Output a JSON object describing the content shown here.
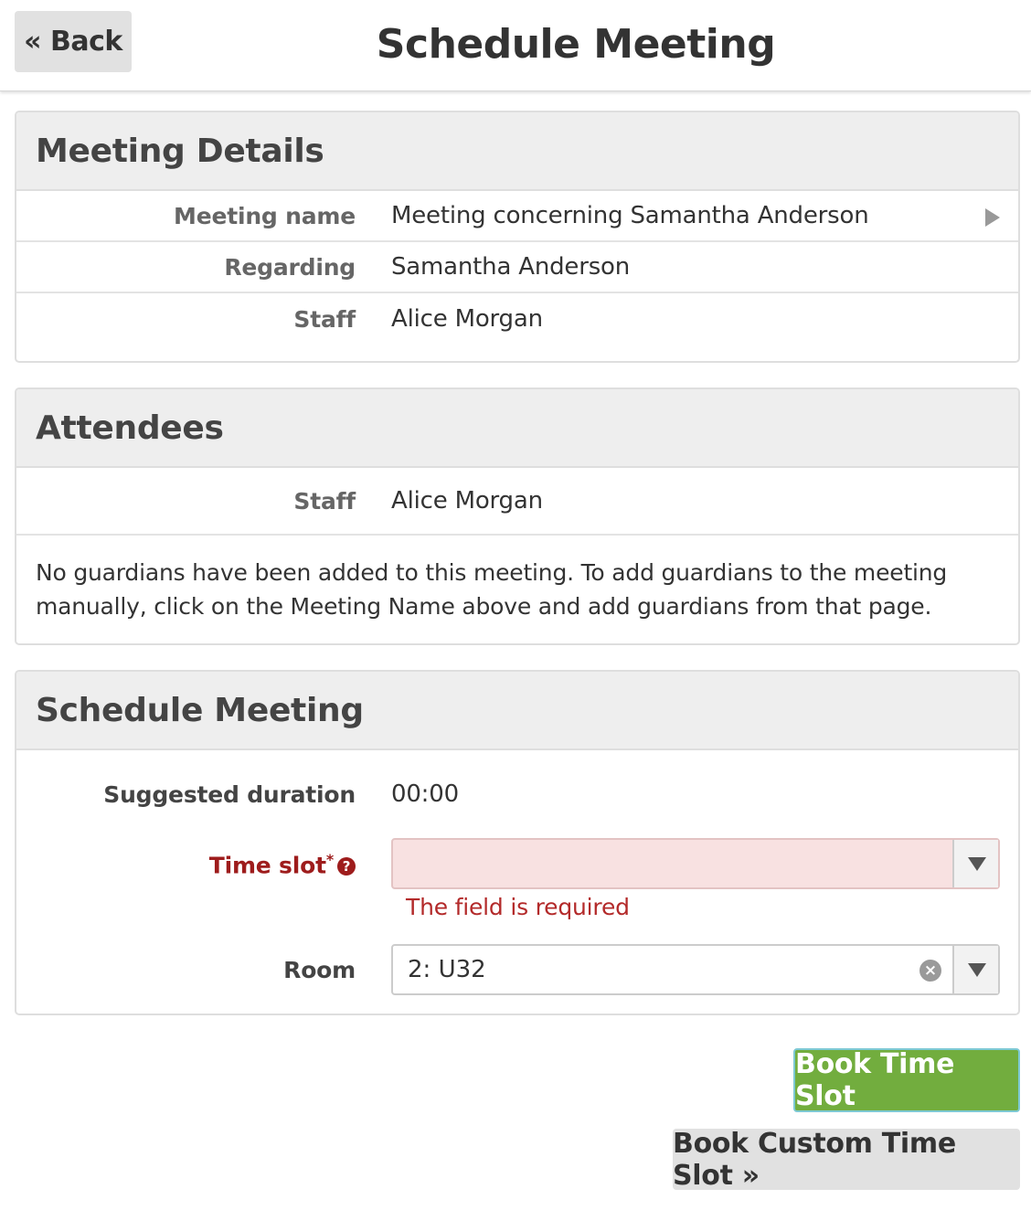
{
  "header": {
    "back_label": "« Back",
    "title": "Schedule Meeting"
  },
  "meeting_details": {
    "title": "Meeting Details",
    "rows": [
      {
        "label": "Meeting name",
        "value": "Meeting concerning Samantha Anderson"
      },
      {
        "label": "Regarding",
        "value": "Samantha Anderson"
      },
      {
        "label": "Staff",
        "value": "Alice Morgan"
      }
    ]
  },
  "attendees": {
    "title": "Attendees",
    "staff_label": "Staff",
    "staff_value": "Alice Morgan",
    "note": "No guardians have been added to this meeting. To add guardians to the meeting manually, click on the Meeting Name above and add guardians from that page."
  },
  "schedule": {
    "title": "Schedule Meeting",
    "duration_label": "Suggested duration",
    "duration_value": "00:00",
    "time_slot_label": "Time slot",
    "required_mark": "*",
    "time_slot_value": "",
    "time_slot_error": "The field is required",
    "room_label": "Room",
    "room_value": "2: U32"
  },
  "actions": {
    "book_time_slot": "Book Time Slot",
    "book_custom_time_slot": "Book Custom Time Slot »"
  },
  "colors": {
    "primary_button": "#72ad3e",
    "error": "#9e1c1c",
    "error_field_bg": "#f8e1e1"
  },
  "icons": {
    "help": "question-circle-icon",
    "clear": "clear-circle-icon",
    "caret": "chevron-down-icon",
    "row_arrow": "chevron-right-icon"
  }
}
